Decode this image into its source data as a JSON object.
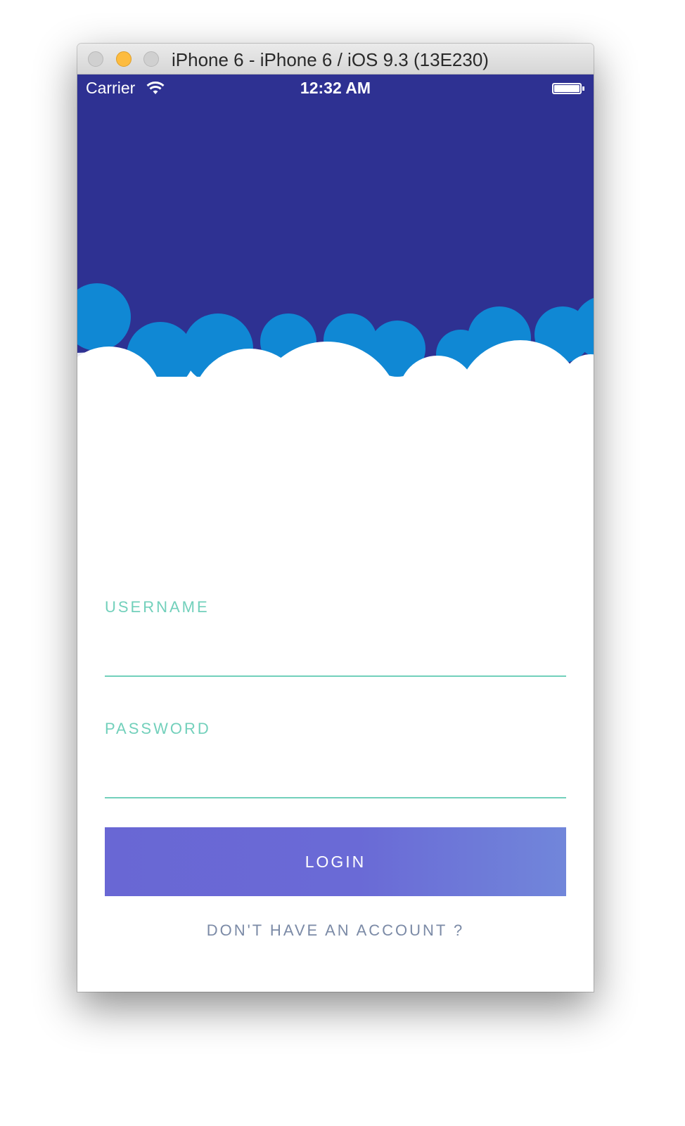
{
  "window": {
    "title": "iPhone 6 - iPhone 6 / iOS 9.3 (13E230)"
  },
  "statusbar": {
    "carrier": "Carrier",
    "time": "12:32 AM",
    "wifi_icon": "wifi-icon",
    "battery_icon": "battery-icon"
  },
  "form": {
    "username_label": "USERNAME",
    "username_value": "",
    "password_label": "PASSWORD",
    "password_value": "",
    "login_label": "LOGIN",
    "signup_link": "DON'T HAVE AN ACCOUNT ?"
  },
  "colors": {
    "header": "#2e3192",
    "cloud_back": "#1088d4",
    "cloud_front": "#ffffff",
    "accent": "#72d0bb",
    "button_start": "#6967d4",
    "button_end": "#7186da",
    "link": "#7b8aa6"
  }
}
